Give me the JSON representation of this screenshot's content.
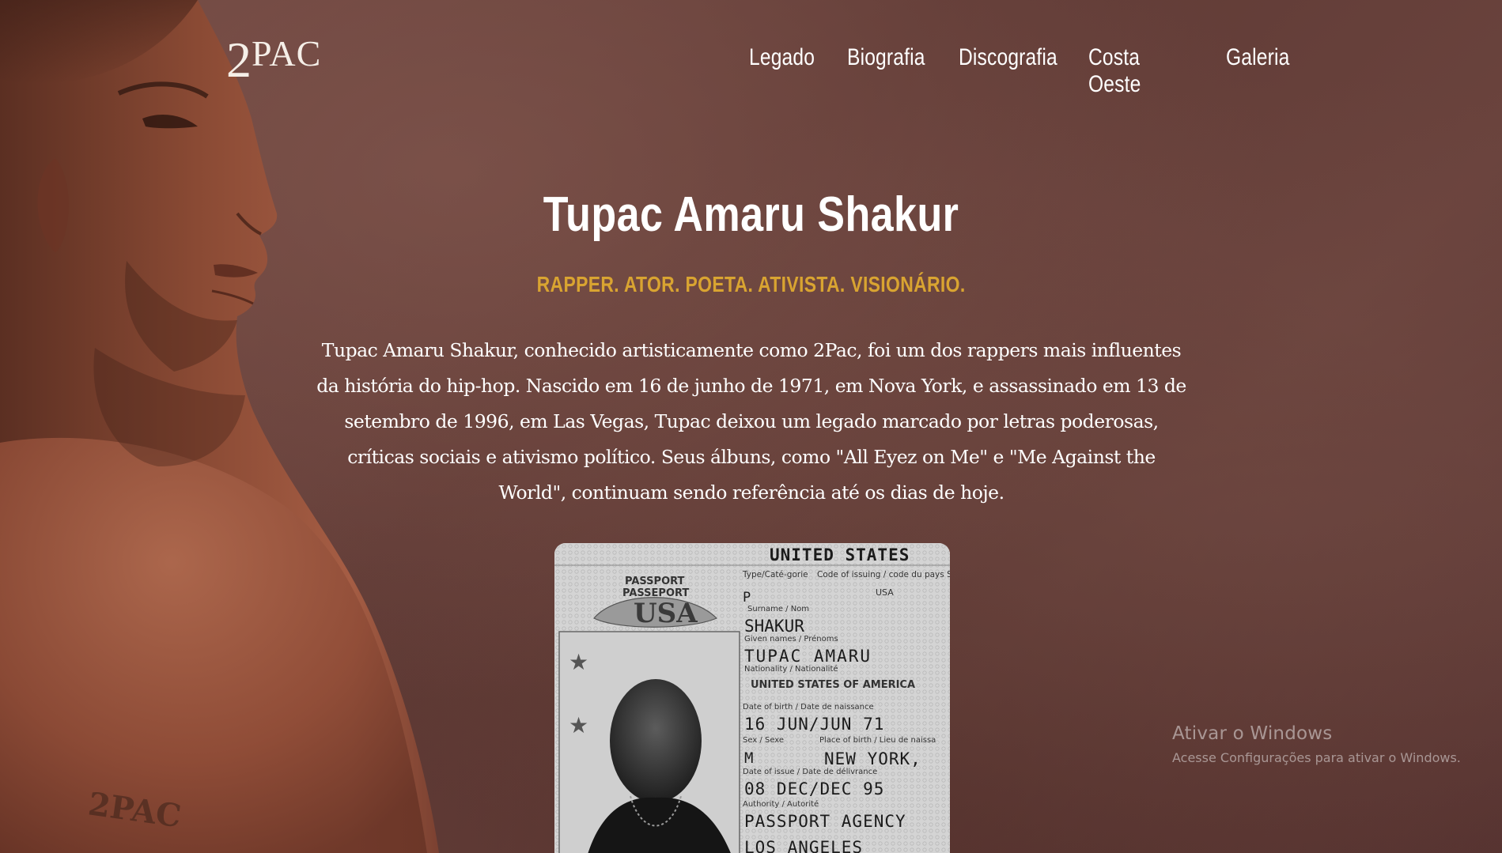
{
  "logo": {
    "big": "2",
    "rest": "PAC"
  },
  "nav": {
    "items": [
      {
        "label": "Legado"
      },
      {
        "label": "Biografia"
      },
      {
        "label": "Discografia"
      },
      {
        "label": "Costa Oeste"
      },
      {
        "label": "Galeria"
      }
    ]
  },
  "hero": {
    "title": "Tupac Amaru Shakur",
    "tagline": "RAPPER. ATOR. POETA. ATIVISTA. VISIONÁRIO.",
    "bio": "Tupac Amaru Shakur, conhecido artisticamente como 2Pac, foi um dos rappers mais influentes da história do hip-hop. Nascido em 16 de junho de 1971, em Nova York, e assassinado em 13 de setembro de 1996, em Las Vegas, Tupac deixou um legado marcado por letras poderosas, críticas sociais e ativismo político. Seus álbuns, como \"All Eyez on Me\" e \"Me Against the World\", continuam sendo referência até os dias de hoje."
  },
  "tattoo": "2PAC",
  "passport": {
    "header": "UNITED STATES",
    "passport_label_1": "PASSPORT",
    "passport_label_2": "PASSEPORT",
    "usa_emblem": "USA",
    "type_label": "Type/Caté-gorie",
    "type_value": "P",
    "code_label": "Code of issuing / code du pays State émetteur",
    "code_value": "USA",
    "surname_label": "Surname / Nom",
    "surname": "SHAKUR",
    "given_label": "Given names / Prénoms",
    "given": "TUPAC AMARU",
    "nationality_label": "Nationality / Nationalité",
    "nationality": "UNITED STATES OF AMERICA",
    "dob_label": "Date of birth / Date de naissance",
    "dob": "16 JUN/JUN 71",
    "sex_label": "Sex / Sexe",
    "pob_label": "Place of birth / Lieu de naissa",
    "sex": "M",
    "pob": "NEW YORK,",
    "issue_label": "Date of issue / Date de délivrance",
    "issue": "08 DEC/DEC 95",
    "authority_label": "Authority / Autorité",
    "authority": "PASSPORT AGENCY",
    "authority_2": "LOS ANGELES"
  },
  "watermark": {
    "title": "Ativar o Windows",
    "subtitle": "Acesse Configurações para ativar o Windows."
  },
  "colors": {
    "background": "#5f3a35",
    "accent_gold": "#d9a431",
    "text": "#ffffff"
  }
}
